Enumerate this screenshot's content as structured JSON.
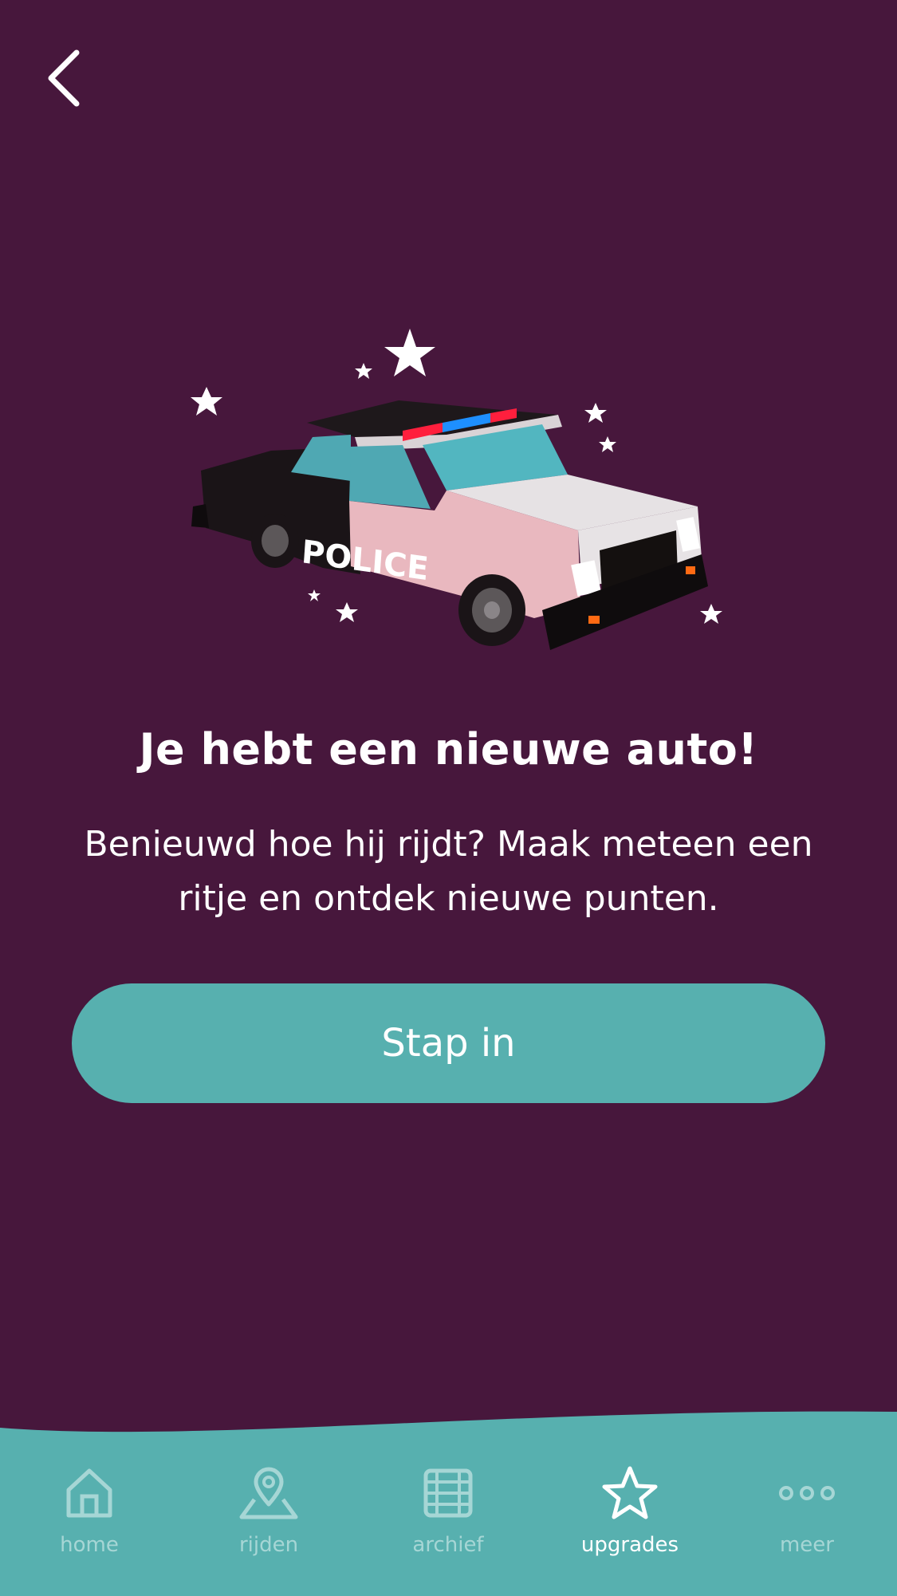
{
  "header": {
    "back_icon": "chevron-left-icon"
  },
  "illustration": {
    "subject": "police-car",
    "car_text": "POLICE"
  },
  "content": {
    "headline": "Je hebt een nieuwe auto!",
    "body": "Benieuwd hoe hij rijdt? Maak meteen een ritje en ontdek nieuwe punten.",
    "cta_label": "Stap in"
  },
  "tabbar": {
    "active": "upgrades",
    "items": [
      {
        "label": "home",
        "icon": "home-icon"
      },
      {
        "label": "rijden",
        "icon": "map-pin-icon"
      },
      {
        "label": "archief",
        "icon": "film-icon"
      },
      {
        "label": "upgrades",
        "icon": "star-icon"
      },
      {
        "label": "meer",
        "icon": "more-dots-icon"
      }
    ]
  },
  "colors": {
    "background": "#47173c",
    "accent": "#57b0af",
    "tab_inactive": "#a6d6d5",
    "text": "#ffffff"
  }
}
